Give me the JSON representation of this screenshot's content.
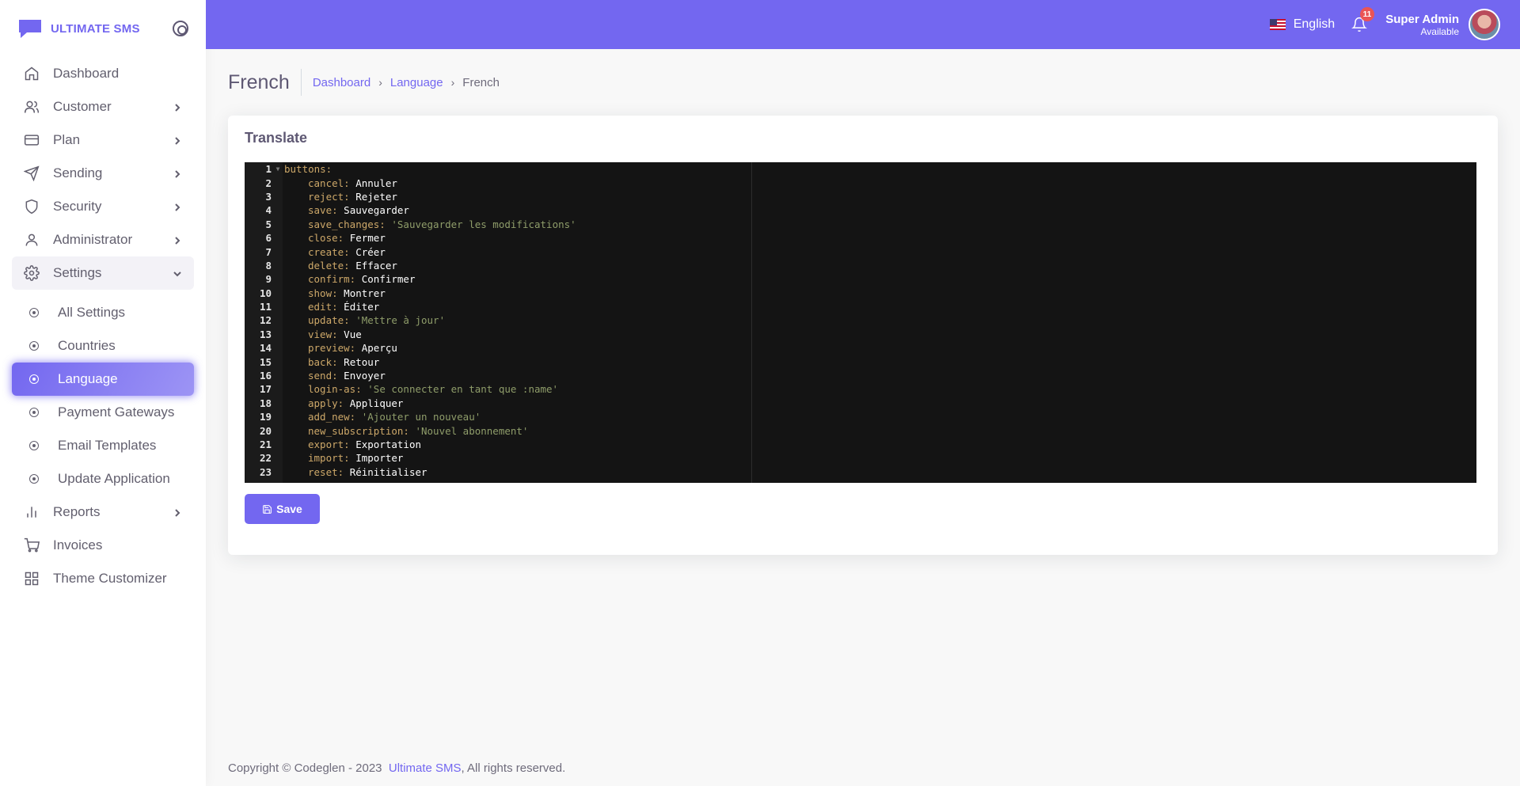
{
  "brand": {
    "name": "ULTIMATE SMS"
  },
  "sidebar": {
    "items": [
      {
        "label": "Dashboard",
        "icon": "home-icon"
      },
      {
        "label": "Customer",
        "icon": "users-icon"
      },
      {
        "label": "Plan",
        "icon": "credit-card-icon"
      },
      {
        "label": "Sending",
        "icon": "send-icon"
      },
      {
        "label": "Security",
        "icon": "shield-icon"
      },
      {
        "label": "Administrator",
        "icon": "user-icon"
      },
      {
        "label": "Settings",
        "icon": "gear-icon"
      }
    ],
    "settings_sub": [
      {
        "label": "All Settings"
      },
      {
        "label": "Countries"
      },
      {
        "label": "Language"
      },
      {
        "label": "Payment Gateways"
      },
      {
        "label": "Email Templates"
      },
      {
        "label": "Update Application"
      }
    ],
    "bottom_items": [
      {
        "label": "Reports",
        "icon": "bar-chart-icon"
      },
      {
        "label": "Invoices",
        "icon": "cart-icon"
      },
      {
        "label": "Theme Customizer",
        "icon": "grid-icon"
      }
    ]
  },
  "header": {
    "language": "English",
    "notification_count": "11",
    "user_name": "Super Admin",
    "user_status": "Available"
  },
  "page": {
    "title": "French",
    "breadcrumb": [
      "Dashboard",
      "Language",
      "French"
    ]
  },
  "card": {
    "title": "Translate",
    "save_label": "Save"
  },
  "editor": {
    "lines": [
      {
        "n": "1",
        "indent": false,
        "key": "buttons:",
        "val": "",
        "str": false,
        "fold": true
      },
      {
        "n": "2",
        "indent": true,
        "key": "cancel:",
        "val": "Annuler",
        "str": false
      },
      {
        "n": "3",
        "indent": true,
        "key": "reject:",
        "val": "Rejeter",
        "str": false
      },
      {
        "n": "4",
        "indent": true,
        "key": "save:",
        "val": "Sauvegarder",
        "str": false
      },
      {
        "n": "5",
        "indent": true,
        "key": "save_changes:",
        "val": "'Sauvegarder les modifications'",
        "str": true
      },
      {
        "n": "6",
        "indent": true,
        "key": "close:",
        "val": "Fermer",
        "str": false
      },
      {
        "n": "7",
        "indent": true,
        "key": "create:",
        "val": "Créer",
        "str": false
      },
      {
        "n": "8",
        "indent": true,
        "key": "delete:",
        "val": "Effacer",
        "str": false
      },
      {
        "n": "9",
        "indent": true,
        "key": "confirm:",
        "val": "Confirmer",
        "str": false
      },
      {
        "n": "10",
        "indent": true,
        "key": "show:",
        "val": "Montrer",
        "str": false
      },
      {
        "n": "11",
        "indent": true,
        "key": "edit:",
        "val": "Éditer",
        "str": false
      },
      {
        "n": "12",
        "indent": true,
        "key": "update:",
        "val": "'Mettre à jour'",
        "str": true
      },
      {
        "n": "13",
        "indent": true,
        "key": "view:",
        "val": "Vue",
        "str": false
      },
      {
        "n": "14",
        "indent": true,
        "key": "preview:",
        "val": "Aperçu",
        "str": false
      },
      {
        "n": "15",
        "indent": true,
        "key": "back:",
        "val": "Retour",
        "str": false
      },
      {
        "n": "16",
        "indent": true,
        "key": "send:",
        "val": "Envoyer",
        "str": false
      },
      {
        "n": "17",
        "indent": true,
        "key": "login-as:",
        "val": "'Se connecter en tant que :name'",
        "str": true
      },
      {
        "n": "18",
        "indent": true,
        "key": "apply:",
        "val": "Appliquer",
        "str": false
      },
      {
        "n": "19",
        "indent": true,
        "key": "add_new:",
        "val": "'Ajouter un nouveau'",
        "str": true
      },
      {
        "n": "20",
        "indent": true,
        "key": "new_subscription:",
        "val": "'Nouvel abonnement'",
        "str": true
      },
      {
        "n": "21",
        "indent": true,
        "key": "export:",
        "val": "Exportation",
        "str": false
      },
      {
        "n": "22",
        "indent": true,
        "key": "import:",
        "val": "Importer",
        "str": false
      },
      {
        "n": "23",
        "indent": true,
        "key": "reset:",
        "val": "Réinitialiser",
        "str": false
      }
    ]
  },
  "footer": {
    "prefix": "Copyright © Codeglen - 2023",
    "link": "Ultimate SMS",
    "suffix": ", All rights reserved."
  },
  "colors": {
    "accent": "#7367f0",
    "badge": "#ea5455",
    "editor_bg": "#141414"
  }
}
